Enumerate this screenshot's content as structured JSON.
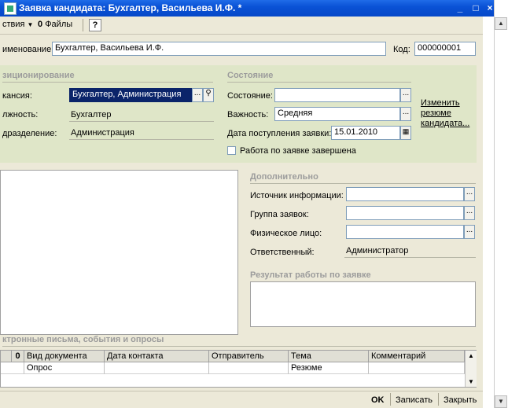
{
  "window": {
    "title": "Заявка кандидата: Бухгалтер, Васильева И.Ф. *"
  },
  "toolbar": {
    "actions_label": "ствия",
    "files_label": "Файлы",
    "help_label": "?"
  },
  "header": {
    "name_label": "именование:",
    "name_value": "Бухгалтер, Васильева И.Ф.",
    "code_label": "Код:",
    "code_value": "000000001"
  },
  "positioning": {
    "title": "зиционирование",
    "vacancy_label": "кансия:",
    "vacancy_value": "Бухгалтер, Администрация",
    "position_label": "лжность:",
    "position_value": "Бухгалтер",
    "division_label": "дразделение:",
    "division_value": "Администрация"
  },
  "state": {
    "title": "Состояние",
    "status_label": "Состояние:",
    "status_value": "",
    "importance_label": "Важность:",
    "importance_value": "Средняя",
    "date_label": "Дата поступления заявки:",
    "date_value": "15.01.2010",
    "completed_label": "Работа по заявке завершена",
    "completed": false,
    "change_resume_link": "Изменить резюме кандидата..."
  },
  "additional": {
    "title": "Дополнительно",
    "source_label": "Источник информации:",
    "source_value": "",
    "group_label": "Группа заявок:",
    "group_value": "",
    "person_label": "Физическое лицо:",
    "person_value": "",
    "responsible_label": "Ответственный:",
    "responsible_value": "Администратор"
  },
  "result": {
    "title": "Результат работы по заявке",
    "value": ""
  },
  "emails": {
    "title": "ктронные письма, события и опросы",
    "columns": [
      "Вид документа",
      "Дата контакта",
      "Отправитель",
      "Тема",
      "Комментарий"
    ],
    "rows": [
      {
        "type": "Опрос",
        "date": "",
        "sender": "",
        "subject": "Резюме",
        "comment": ""
      }
    ]
  },
  "footer": {
    "ok_label": "OK",
    "save_label": "Записать",
    "close_label": "Закрыть"
  }
}
